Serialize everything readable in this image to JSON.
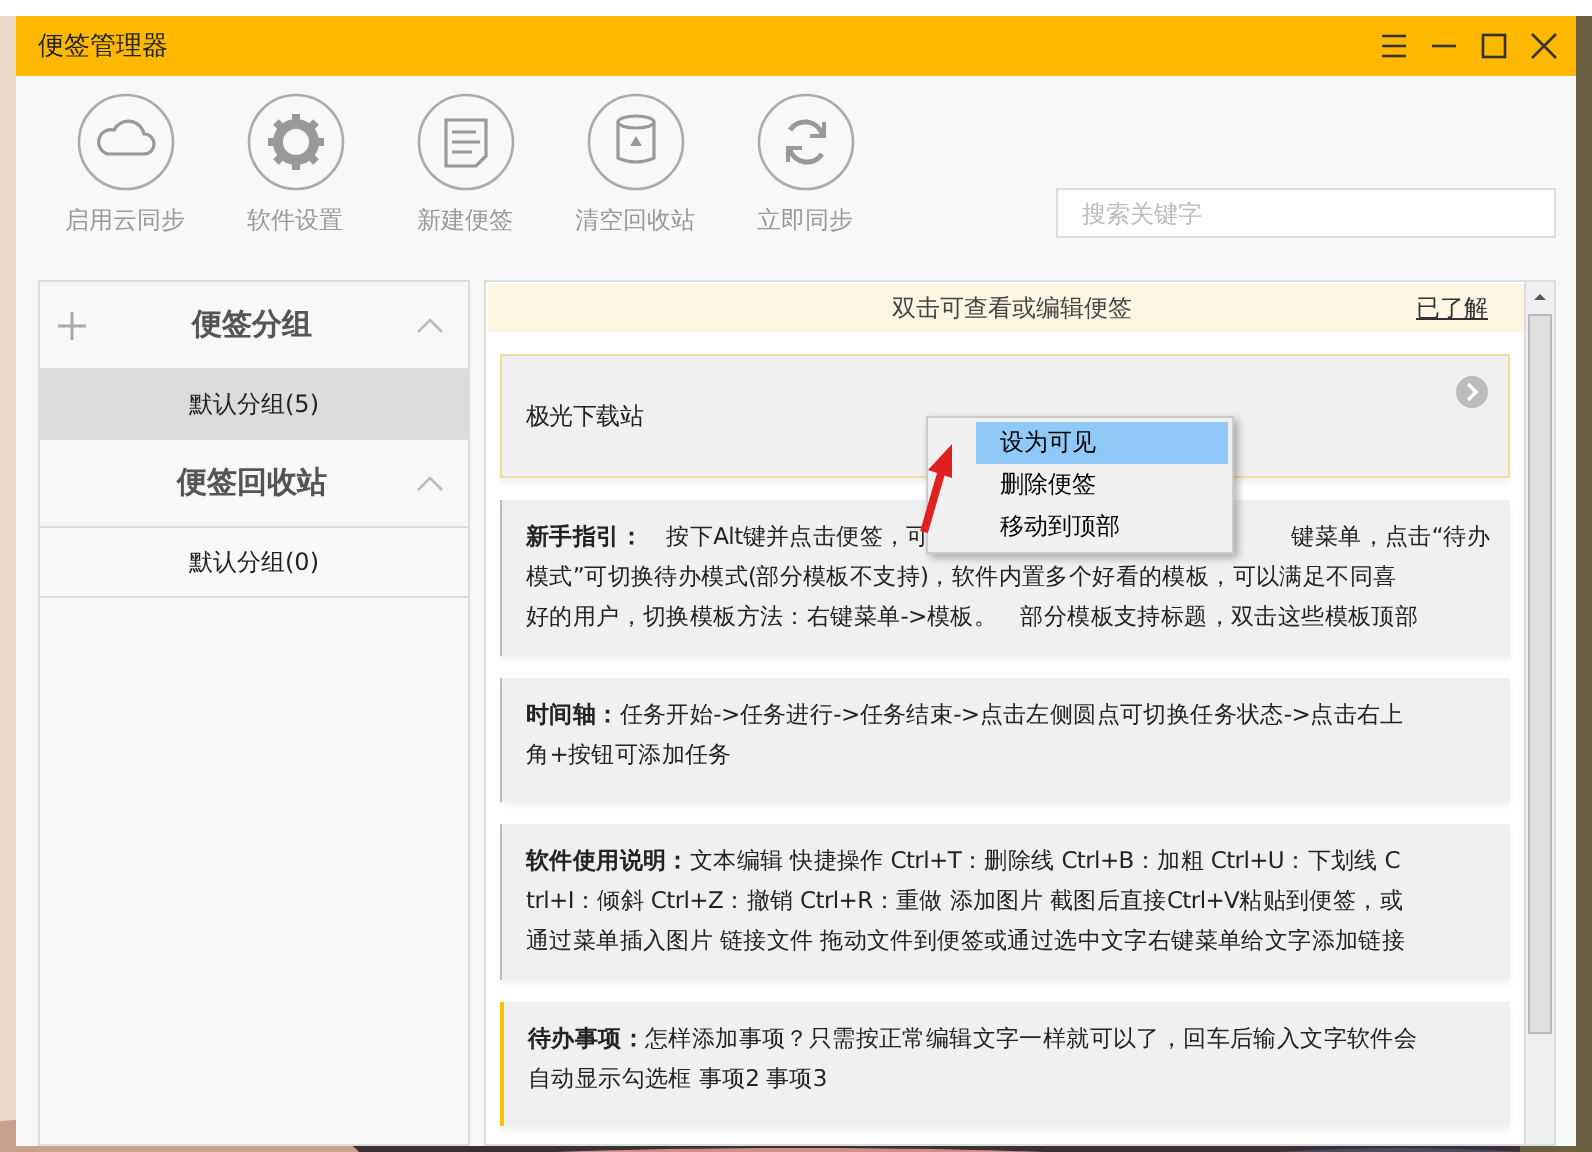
{
  "window": {
    "title": "便签管理器"
  },
  "toolbar": [
    {
      "label": "启用云同步"
    },
    {
      "label": "软件设置"
    },
    {
      "label": "新建便签"
    },
    {
      "label": "清空回收站"
    },
    {
      "label": "立即同步"
    }
  ],
  "search": {
    "placeholder": "搜索关键字"
  },
  "sidebar": [
    {
      "title": "便签分组",
      "add": true,
      "expanded": true,
      "items": [
        {
          "label": "默认分组(5)",
          "selected": true
        }
      ]
    },
    {
      "title": "便签回收站",
      "add": false,
      "expanded": true,
      "items": [
        {
          "label": "默认分组(0)",
          "selected": false
        }
      ]
    }
  ],
  "banner": {
    "text": "双击可查看或编辑便签",
    "link": "已了解"
  },
  "notes": [
    {
      "kind": "hidden",
      "lines": [
        [
          "极光下载站"
        ]
      ]
    },
    {
      "kind": "note",
      "lines": [
        [
          "**新手指引：**　按下Alt键并点击便签，可",
          "键菜单，点击“待办"
        ],
        [
          "模式”可切换待办模式(部分模板不支持)，软件内置多个好看的模板，可以满足不同喜"
        ],
        [
          "好的用户，切换模板方法：右键菜单->模板。　部分模板支持标题，双击这些模板顶部"
        ]
      ]
    },
    {
      "kind": "note",
      "lines": [
        [
          "**时间轴：**任务开始->任务进行->任务结束->点击左侧圆点可切换任务状态->点击右上"
        ],
        [
          "角+按钮可添加任务"
        ]
      ]
    },
    {
      "kind": "note",
      "lines": [
        [
          "**软件使用说明：**文本编辑  快捷操作 Ctrl+T：删除线 Ctrl+B：加粗 Ctrl+U：下划线 C"
        ],
        [
          "trl+I：倾斜 Ctrl+Z：撤销 Ctrl+R：重做  添加图片 截图后直接Ctrl+V粘贴到便签，或"
        ],
        [
          "通过菜单插入图片  链接文件 拖动文件到便签或通过选中文字右键菜单给文字添加链接"
        ]
      ]
    },
    {
      "kind": "todo",
      "lines": [
        [
          "**待办事项：**怎样添加事项？只需按正常编辑文字一样就可以了，回车后输入文字软件会"
        ],
        [
          "自动显示勾选框 事项2 事项3"
        ]
      ]
    }
  ],
  "context_menu": [
    {
      "label": "设为可见",
      "selected": true
    },
    {
      "label": "删除便签",
      "selected": false
    },
    {
      "label": "移动到顶部",
      "selected": false
    }
  ]
}
